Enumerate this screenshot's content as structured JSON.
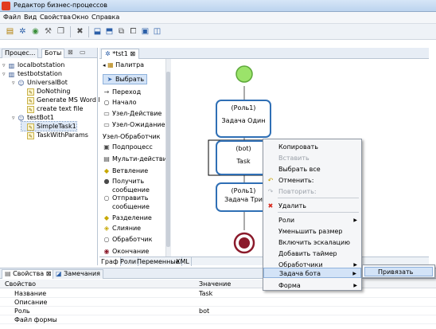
{
  "window": {
    "title": "Редактор бизнес-процессов"
  },
  "menu": [
    "Файл",
    "Вид",
    "Свойства",
    "Окно",
    "Справка"
  ],
  "left_panel": {
    "tabs": [
      "Процес...",
      "Боты"
    ],
    "tree": [
      {
        "label": "localbotstation",
        "level": 0,
        "icon": "computer-icon"
      },
      {
        "label": "testbotstation",
        "level": 0,
        "icon": "computer-icon"
      },
      {
        "label": "UniversalBot",
        "level": 1,
        "icon": "bot-icon"
      },
      {
        "label": "DoNothing",
        "level": 2,
        "icon": "task-icon"
      },
      {
        "label": "Generate MS Word Re",
        "level": 2,
        "icon": "task-icon"
      },
      {
        "label": "create text file",
        "level": 2,
        "icon": "task-icon"
      },
      {
        "label": "testBot1",
        "level": 1,
        "icon": "bot-icon"
      },
      {
        "label": "SimpleTask1",
        "level": 2,
        "icon": "task-icon",
        "selected": true
      },
      {
        "label": "TaskWithParams",
        "level": 2,
        "icon": "task-icon"
      }
    ]
  },
  "editor": {
    "tab_label": "*tst1",
    "palette_title": "Палитра",
    "palette_items": [
      {
        "label": "Выбрать",
        "icon": "pointer-icon",
        "selected": true
      },
      {
        "label": "Переход",
        "icon": "arrow-icon"
      },
      {
        "label": "Начало",
        "icon": "start-icon"
      },
      {
        "label": "Узел-Действие",
        "icon": "action-node-icon"
      },
      {
        "label": "Узел-Ожидание",
        "icon": "wait-node-icon"
      },
      {
        "label": "Узел-Обработчик",
        "icon": ""
      },
      {
        "label": "Подпроцесс",
        "icon": "subprocess-icon"
      },
      {
        "label": "Мульти-действие",
        "icon": "multi-action-icon"
      },
      {
        "label": "Ветвление",
        "icon": "fork-icon"
      },
      {
        "label": "Получить",
        "label2": "сообщение",
        "icon": "receive-message-icon"
      },
      {
        "label": "Отправить",
        "label2": "сообщение",
        "icon": "send-message-icon"
      },
      {
        "label": "Разделение",
        "icon": "split-icon"
      },
      {
        "label": "Слияние",
        "icon": "merge-icon"
      },
      {
        "label": "Обработчик",
        "icon": "handler-icon"
      },
      {
        "label": "Окончание",
        "icon": "end-icon"
      }
    ],
    "bottom_tabs": [
      "Граф",
      "Роли",
      "Переменные",
      "XML"
    ],
    "nodes": [
      {
        "role": "(Роль1)",
        "name": "Задача Один"
      },
      {
        "role": "(bot)",
        "name": "Task"
      },
      {
        "role": "(Роль1)",
        "name": "Задача Три"
      }
    ]
  },
  "context_menu": {
    "items": [
      {
        "label": "Копировать",
        "icon": "",
        "enabled": true
      },
      {
        "label": "Вставить",
        "icon": "",
        "enabled": false
      },
      {
        "label": "Выбрать все",
        "icon": "",
        "enabled": true
      },
      {
        "label": "Отменить:",
        "icon": "undo-icon",
        "enabled": true
      },
      {
        "label": "Повторить:",
        "icon": "redo-icon",
        "enabled": false
      },
      {
        "label": "Удалить",
        "icon": "delete-icon",
        "enabled": true
      },
      {
        "label": "Роли",
        "icon": "",
        "enabled": true,
        "submenu": true
      },
      {
        "label": "Уменьшить размер",
        "icon": "",
        "enabled": true
      },
      {
        "label": "Включить эскалацию",
        "icon": "",
        "enabled": true
      },
      {
        "label": "Добавить таймер",
        "icon": "",
        "enabled": true
      },
      {
        "label": "Обработчики",
        "icon": "",
        "enabled": true,
        "submenu": true
      },
      {
        "label": "Задача бота",
        "icon": "",
        "enabled": true,
        "submenu": true,
        "highlighted": true
      },
      {
        "label": "Форма",
        "icon": "",
        "enabled": true,
        "submenu": true
      }
    ],
    "submenu": {
      "label": "Привязать"
    }
  },
  "properties": {
    "tabs": [
      "Свойства",
      "Замечания"
    ],
    "columns": [
      "Свойство",
      "Значение"
    ],
    "rows": [
      {
        "name": "Название",
        "value": "Task"
      },
      {
        "name": "Описание",
        "value": ""
      },
      {
        "name": "Роль",
        "value": "bot"
      },
      {
        "name": "Файл формы",
        "value": ""
      }
    ]
  },
  "colors": {
    "node_border": "#2f6fb5",
    "start": "#9be36a",
    "end": "#8b1a2b",
    "menu_highlight": "#d3e3f7"
  }
}
